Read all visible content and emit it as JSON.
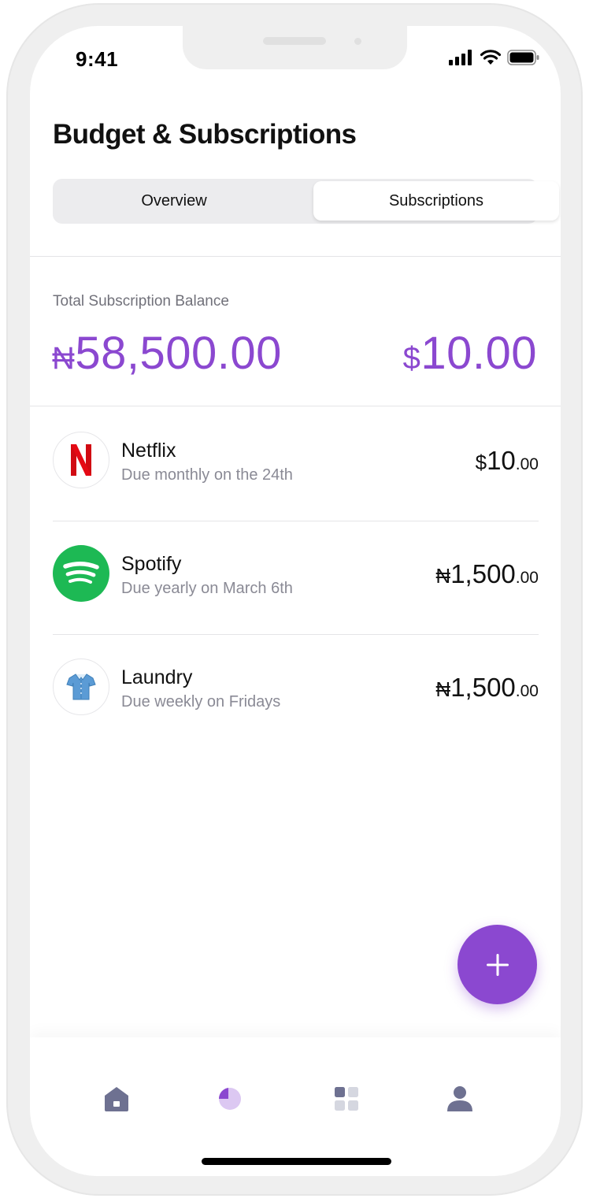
{
  "status_bar": {
    "time": "9:41"
  },
  "header": {
    "title": "Budget & Subscriptions"
  },
  "segment": {
    "tabs": [
      "Overview",
      "Subscriptions"
    ],
    "active": "Subscriptions"
  },
  "balance": {
    "label": "Total Subscription Balance",
    "naira_symbol": "₦",
    "naira_amount": "58,500.00",
    "dollar_symbol": "$",
    "dollar_amount": "10.00"
  },
  "subscriptions": [
    {
      "name": "Netflix",
      "due": "Due monthly on the 24th",
      "currency": "$",
      "whole": "10",
      "cents": ".00",
      "icon": "netflix-icon"
    },
    {
      "name": "Spotify",
      "due": "Due yearly on March 6th",
      "currency": "₦",
      "whole": "1,500",
      "cents": ".00",
      "icon": "spotify-icon"
    },
    {
      "name": "Laundry",
      "due": "Due weekly on Fridays",
      "currency": "₦",
      "whole": "1,500",
      "cents": ".00",
      "icon": "shirt-icon"
    }
  ],
  "fab": {
    "icon": "plus-icon"
  },
  "nav": [
    {
      "icon": "home-icon",
      "active": false
    },
    {
      "icon": "pie-chart-icon",
      "active": true
    },
    {
      "icon": "grid-icon",
      "active": false
    },
    {
      "icon": "user-icon",
      "active": false
    }
  ],
  "colors": {
    "accent": "#8b48d0",
    "spotify": "#1db954",
    "netflix": "#d10a12"
  }
}
